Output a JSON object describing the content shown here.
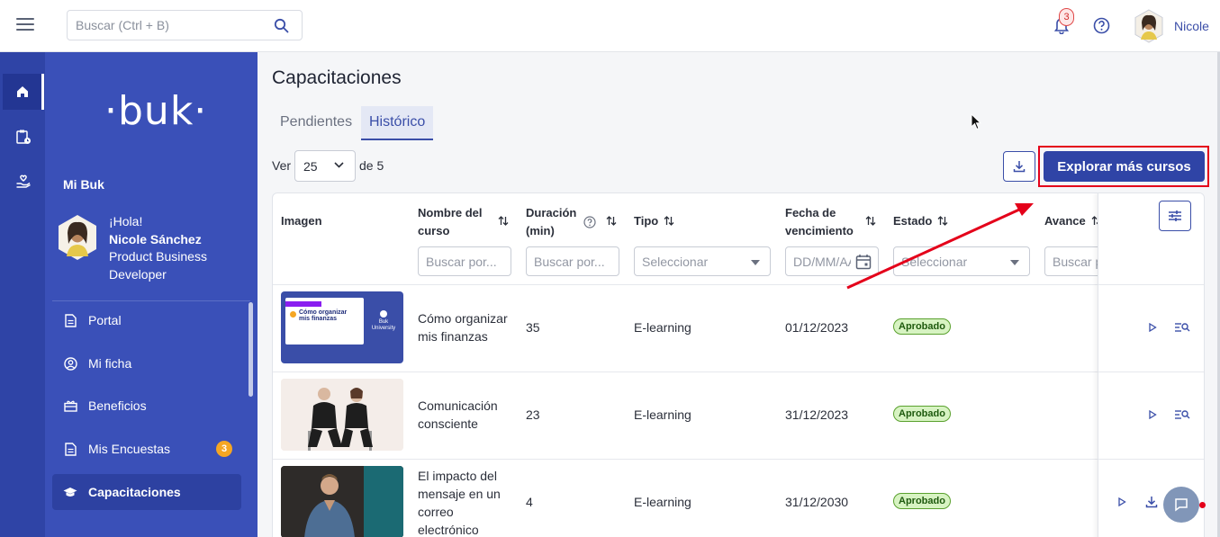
{
  "topbar": {
    "search_placeholder": "Buscar (Ctrl + B)",
    "notifications_count": "3",
    "user_name": "Nicole"
  },
  "sidebar": {
    "logo": "buk",
    "section_title": "Mi Buk",
    "greeting": "¡Hola!",
    "full_name": "Nicole Sánchez",
    "role": "Product Business Developer",
    "items": [
      {
        "label": "Portal",
        "icon": "document-icon"
      },
      {
        "label": "Mi ficha",
        "icon": "user-circle-icon"
      },
      {
        "label": "Beneficios",
        "icon": "gift-icon"
      },
      {
        "label": "Mis Encuestas",
        "icon": "document-icon",
        "badge": "3"
      },
      {
        "label": "Capacitaciones",
        "icon": "graduation-cap-icon",
        "active": true
      }
    ]
  },
  "main": {
    "title": "Capacitaciones",
    "tabs": [
      {
        "label": "Pendientes",
        "active": false
      },
      {
        "label": "Histórico",
        "active": true
      }
    ],
    "pagination": {
      "ver_label": "Ver",
      "page_size": "25",
      "of_label": "de 5"
    },
    "explore_button": "Explorar más cursos"
  },
  "table": {
    "headers": {
      "image": "Imagen",
      "course_name": [
        "Nombre del",
        "curso"
      ],
      "duration": [
        "Duración",
        "(min)"
      ],
      "type": "Tipo",
      "due_date": [
        "Fecha de",
        "vencimiento"
      ],
      "status": "Estado",
      "progress": "Avance"
    },
    "filters": {
      "course_name": "Buscar por...",
      "duration": "Buscar por...",
      "type": "Seleccionar",
      "due_date": "DD/MM/AAAA",
      "status": "Seleccionar",
      "progress": "Buscar por..."
    },
    "rows": [
      {
        "name": [
          "Cómo organizar",
          "mis finanzas"
        ],
        "duration": "35",
        "type": "E-learning",
        "due": "01/12/2023",
        "status": "Aprobado",
        "thumb_title": "Cómo organizar mis finanzas",
        "thumb_brand": "Buk University"
      },
      {
        "name": [
          "Comunicación",
          "consciente"
        ],
        "duration": "23",
        "type": "E-learning",
        "due": "31/12/2023",
        "status": "Aprobado"
      },
      {
        "name": [
          "El impacto del",
          "mensaje en un",
          "correo",
          "electrónico"
        ],
        "duration": "4",
        "type": "E-learning",
        "due": "31/12/2030",
        "status": "Aprobado"
      }
    ]
  },
  "colors": {
    "brand": "#2f44a6",
    "sidebar": "#3a50b8",
    "highlight": "#e4001a",
    "status_ok": "#d7f3c2"
  }
}
